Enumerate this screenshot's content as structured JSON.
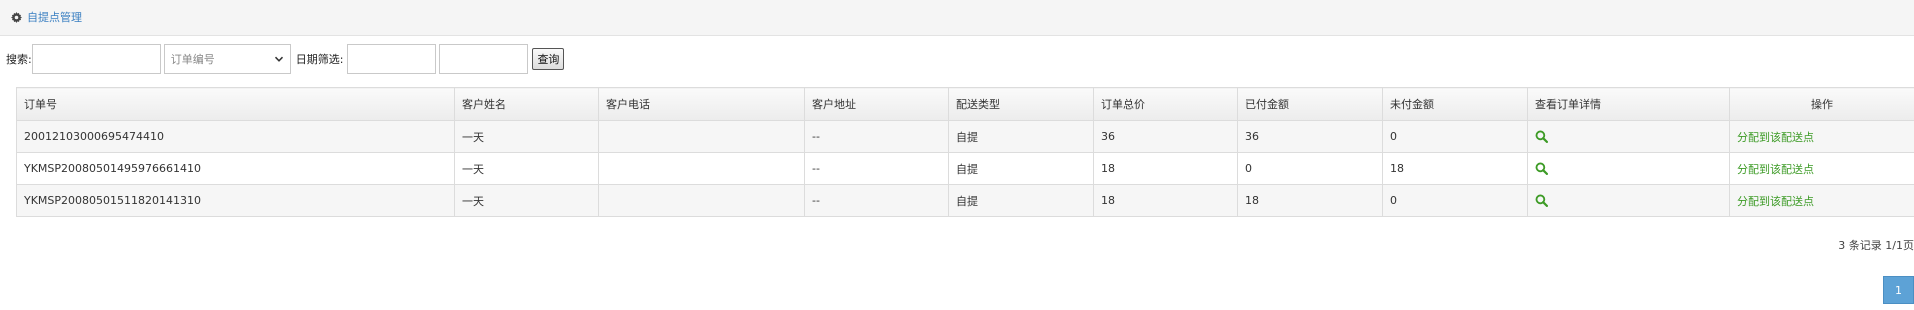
{
  "breadcrumb": {
    "label": "自提点管理",
    "icon": "gear-icon"
  },
  "search": {
    "label": "搜索:",
    "keyword_value": "",
    "field_select_value": "订单编号",
    "date_label": "日期筛选:",
    "date_from_value": "",
    "date_to_value": "",
    "query_button": "查询"
  },
  "table": {
    "headers": [
      "订单号",
      "客户姓名",
      "客户电话",
      "客户地址",
      "配送类型",
      "订单总价",
      "已付金额",
      "未付金额",
      "查看订单详情",
      "操作"
    ],
    "rows": [
      {
        "order_no": "20012103000695474410",
        "name": "一天",
        "phone": "",
        "address": "--",
        "delivery": "自提",
        "total": "36",
        "paid": "36",
        "unpaid": "0",
        "action": "分配到该配送点"
      },
      {
        "order_no": "YKMSP20080501495976661410",
        "name": "一天",
        "phone": "",
        "address": "--",
        "delivery": "自提",
        "total": "18",
        "paid": "0",
        "unpaid": "18",
        "action": "分配到该配送点"
      },
      {
        "order_no": "YKMSP20080501511820141310",
        "name": "一天",
        "phone": "",
        "address": "--",
        "delivery": "自提",
        "total": "18",
        "paid": "18",
        "unpaid": "0",
        "action": "分配到该配送点"
      }
    ]
  },
  "pagination": {
    "summary": "3 条记录 1/1页",
    "current_page": "1"
  },
  "colors": {
    "link_blue": "#3a7fc1",
    "action_green": "#3d9b26",
    "page_active": "#5da2d6"
  }
}
